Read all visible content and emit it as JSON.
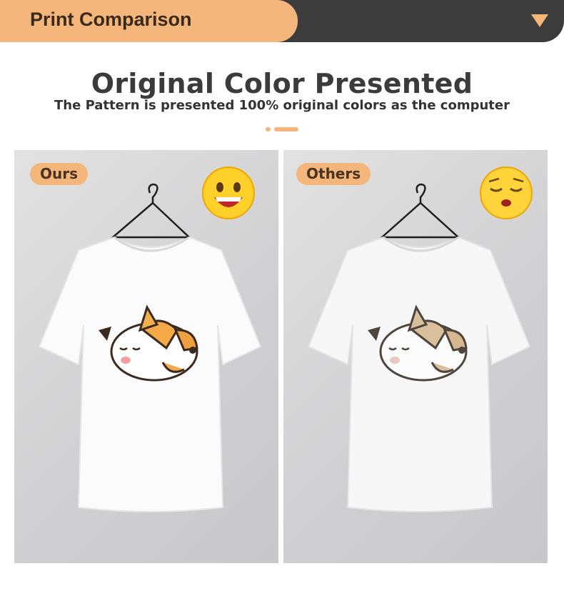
{
  "header": {
    "title": "Print Comparison",
    "toggle_icon": "triangle-down-icon"
  },
  "headline": "Original Color Presented",
  "subheadline": "The Pattern is presented 100% original colors as the computer",
  "panels": [
    {
      "tag": "Ours",
      "emoji": "grinning-face-icon",
      "print": "vivid"
    },
    {
      "tag": "Others",
      "emoji": "pensive-face-icon",
      "print": "faded"
    }
  ],
  "colors": {
    "accent": "#f4b67b",
    "header_dark": "#3c3c3c",
    "text": "#3b3b3b"
  }
}
